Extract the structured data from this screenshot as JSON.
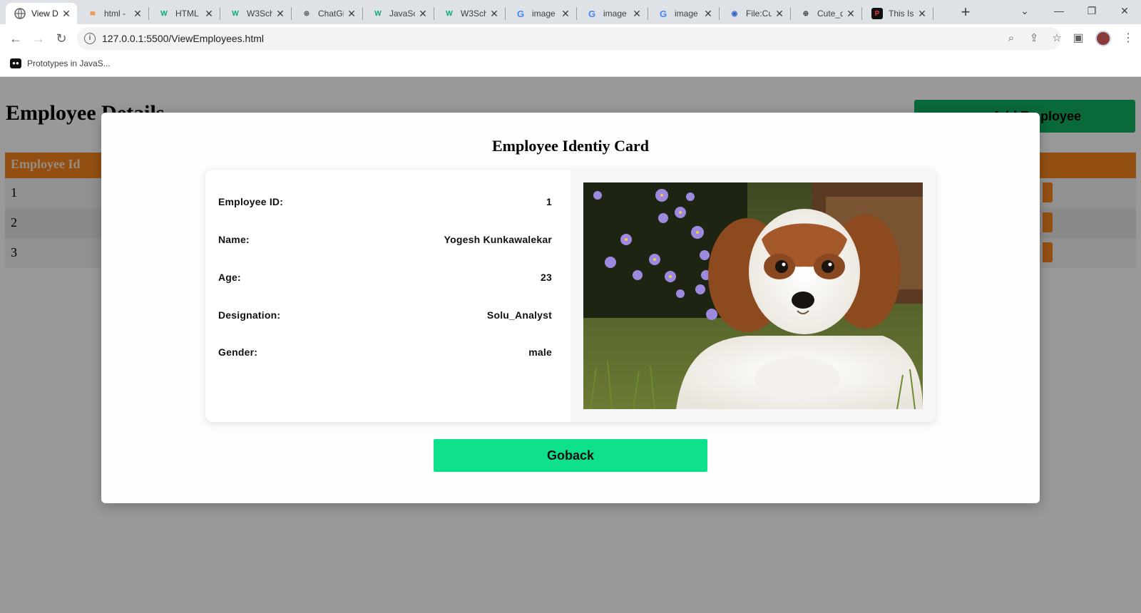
{
  "browser": {
    "tabs": [
      {
        "title": "View D",
        "icon": "globe-icon",
        "active": true
      },
      {
        "title": "html - ",
        "icon": "stackoverflow-icon"
      },
      {
        "title": "HTML ",
        "icon": "w3schools-icon"
      },
      {
        "title": "W3Sch",
        "icon": "w3schools-icon"
      },
      {
        "title": "ChatGF",
        "icon": "chatgpt-icon"
      },
      {
        "title": "JavaScr",
        "icon": "w3schools-icon"
      },
      {
        "title": "W3Sch",
        "icon": "w3schools-icon"
      },
      {
        "title": "image ",
        "icon": "google-icon"
      },
      {
        "title": "image ",
        "icon": "google-icon"
      },
      {
        "title": "image ",
        "icon": "google-icon"
      },
      {
        "title": "File:Cu",
        "icon": "wikimedia-icon"
      },
      {
        "title": "Cute_d",
        "icon": "wikipedia-icon"
      },
      {
        "title": "This Is",
        "icon": "page-icon"
      }
    ],
    "url": "127.0.0.1:5500/ViewEmployees.html",
    "bookmark": "Prototypes in JavaS..."
  },
  "page": {
    "title": "Employee Details",
    "add_button": "Add Employee",
    "table_header": "Employee Id",
    "rows": [
      "1",
      "2",
      "3"
    ]
  },
  "modal": {
    "title": "Employee Identiy Card",
    "fields": [
      {
        "label": "Employee ID:",
        "value": "1"
      },
      {
        "label": "Name:",
        "value": "Yogesh Kunkawalekar"
      },
      {
        "label": "Age:",
        "value": "23"
      },
      {
        "label": "Designation:",
        "value": "Solu_Analyst"
      },
      {
        "label": "Gender:",
        "value": "male"
      }
    ],
    "goback": "Goback"
  },
  "colors": {
    "add_button": "#10b060",
    "table_header": "#f5841f",
    "goback": "#0fe08c"
  }
}
